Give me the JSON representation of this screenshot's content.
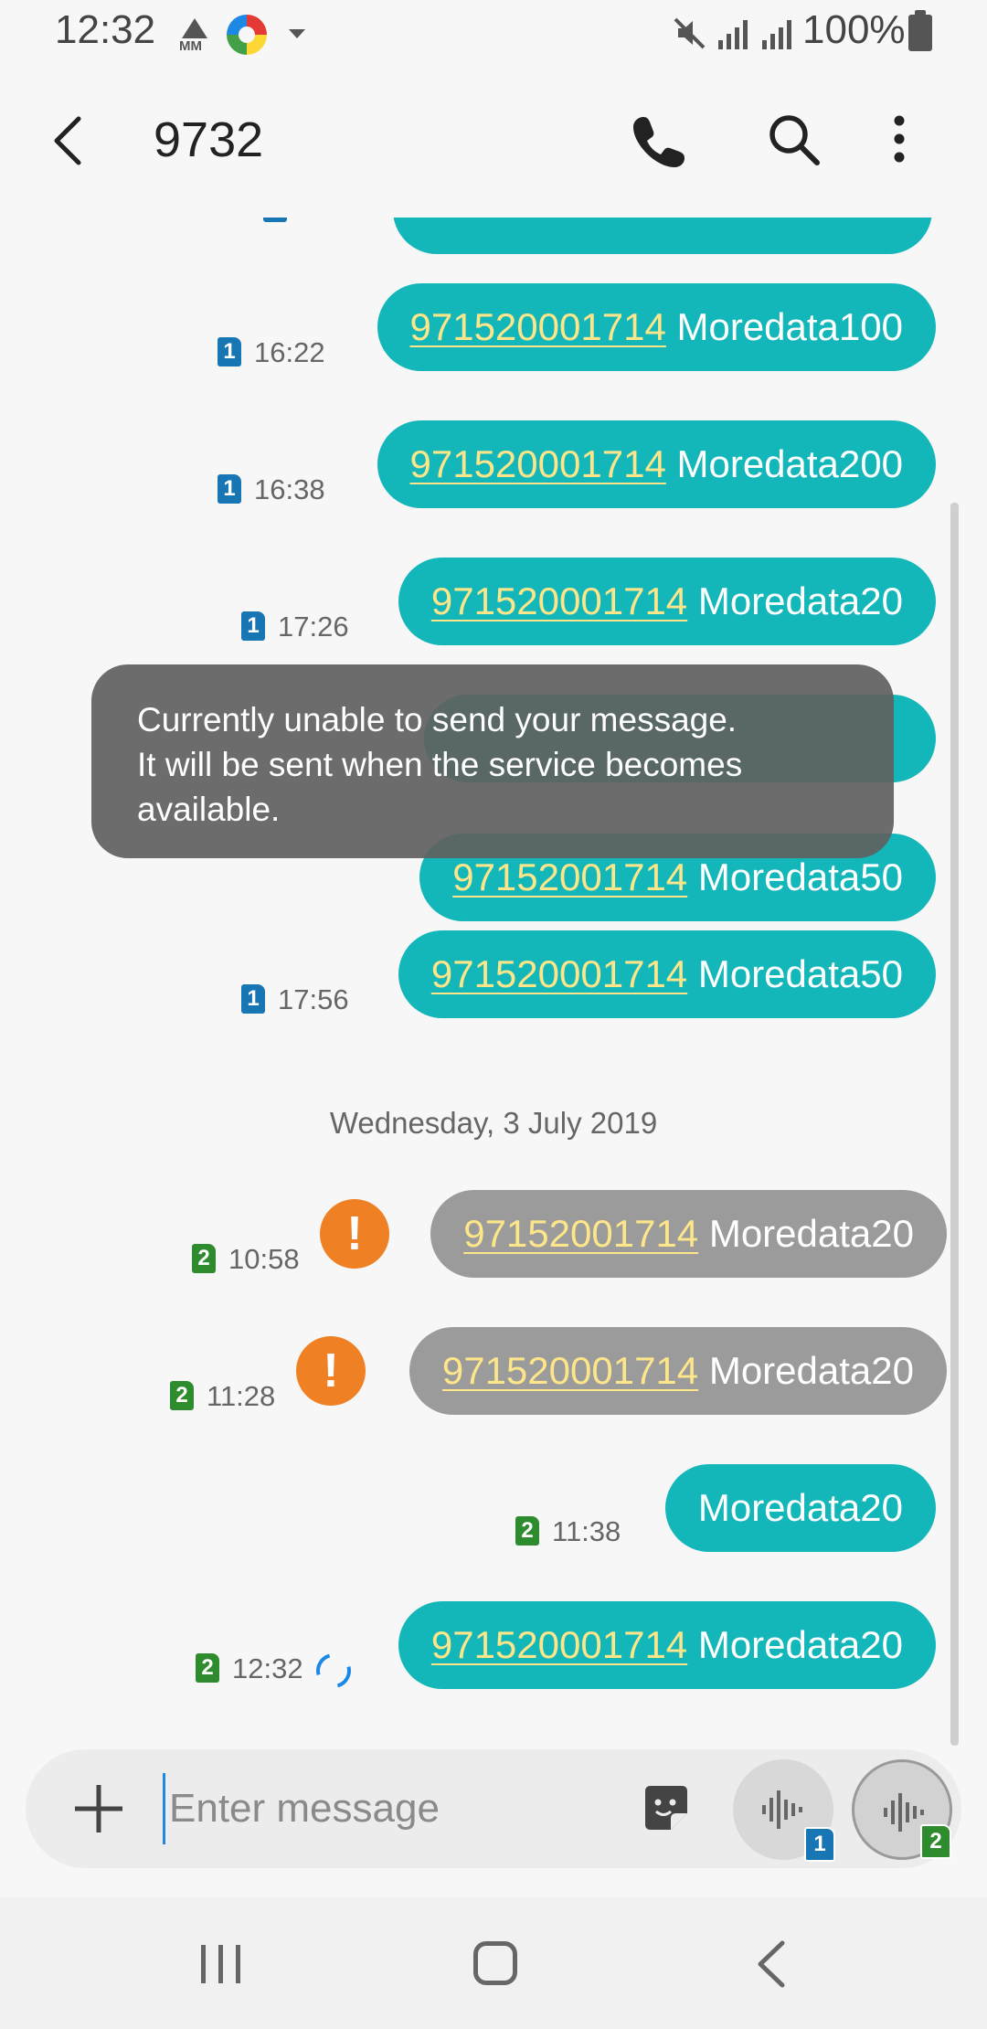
{
  "status_bar": {
    "time": "12:32",
    "mm_label": "MM",
    "battery": "100%"
  },
  "header": {
    "title": "9732",
    "icons": [
      "back-icon",
      "phone-icon",
      "search-icon",
      "more-vert-icon"
    ]
  },
  "messages": [
    {
      "number": "971520001714",
      "text": " Moredata100",
      "sim": "1",
      "time": "16:22",
      "status": "sent"
    },
    {
      "number": "971520001714",
      "text": " Moredata200",
      "sim": "1",
      "time": "16:38",
      "status": "sent"
    },
    {
      "number": "971520001714",
      "text": " Moredata20",
      "sim": "1",
      "time": "17:26",
      "status": "sent"
    },
    {
      "number": "97152001714",
      "text": " Moredata50",
      "sim": "",
      "time": "",
      "status": "sent"
    },
    {
      "number": "971520001714",
      "text": " Moredata50",
      "sim": "1",
      "time": "17:56",
      "status": "sent"
    },
    {
      "number": "97152001714",
      "text": " Moredata20",
      "sim": "2",
      "time": "10:58",
      "status": "failed"
    },
    {
      "number": "971520001714",
      "text": " Moredata20",
      "sim": "2",
      "time": "11:28",
      "status": "failed"
    },
    {
      "number": "",
      "text": "Moredata20",
      "sim": "2",
      "time": "11:38",
      "status": "sent"
    },
    {
      "number": "971520001714",
      "text": " Moredata20",
      "sim": "2",
      "time": "12:32",
      "status": "sending"
    }
  ],
  "date_divider": "Wednesday, 3 July 2019",
  "error_mark": "!",
  "toast": {
    "line1": "Currently unable to send your message.",
    "line2": "It will be sent when the service becomes",
    "line3": "available."
  },
  "composer": {
    "placeholder": "Enter message",
    "voice_sim_1": "1",
    "voice_sim_2": "2"
  },
  "colors": {
    "sent_bubble": "#13b7ba",
    "failed_bubble": "#9b9b9b",
    "link_number": "#fde68a",
    "error_icon": "#ef8023",
    "sim1": "#1976b5",
    "sim2": "#2e8b2e"
  }
}
